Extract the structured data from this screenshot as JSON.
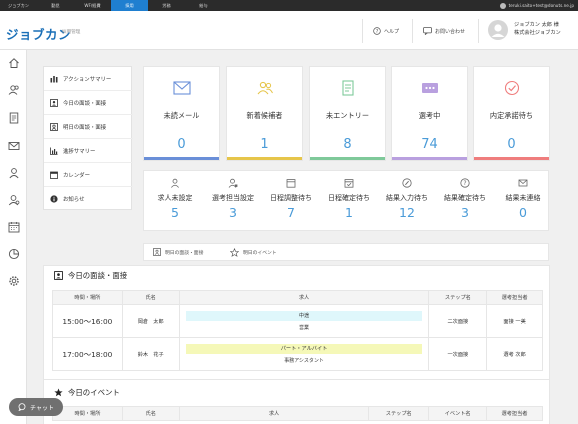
{
  "topbar": {
    "tabs": [
      "ジョブカン",
      "勤怠",
      "WF/経費",
      "採用",
      "労務",
      "給与"
    ],
    "active_index": 3,
    "user_email": "teruki.saito+test@donuts.ne.jp"
  },
  "header": {
    "logo": "ジョブカン",
    "logo_sub": "採用管理",
    "help": "ヘルプ",
    "contact": "お問い合わせ",
    "user_name": "ジョブカン 太郎 様",
    "company": "株式会社ジョブカン"
  },
  "menu": [
    {
      "label": "アクションサマリー",
      "icon": "bar-chart-icon"
    },
    {
      "label": "今日の面談・面接",
      "icon": "person-card-icon"
    },
    {
      "label": "明日の面談・面接",
      "icon": "person-card-icon"
    },
    {
      "label": "進捗サマリー",
      "icon": "progress-chart-icon"
    },
    {
      "label": "カレンダー",
      "icon": "calendar-icon"
    },
    {
      "label": "お知らせ",
      "icon": "info-icon"
    }
  ],
  "cards": [
    {
      "label": "未読メール",
      "value": "0",
      "color": "#6a8fd8",
      "icon": "mail-icon"
    },
    {
      "label": "新着候補者",
      "value": "1",
      "color": "#e6c54a",
      "icon": "people-icon"
    },
    {
      "label": "未エントリー",
      "value": "8",
      "color": "#7fc99a",
      "icon": "document-icon"
    },
    {
      "label": "選考中",
      "value": "74",
      "color": "#b9a0df",
      "icon": "message-icon"
    },
    {
      "label": "内定承諾待ち",
      "value": "0",
      "color": "#ef7d7d",
      "icon": "check-circle-icon"
    }
  ],
  "stats": [
    {
      "label": "求人未設定",
      "value": "5",
      "icon": "user-icon"
    },
    {
      "label": "選考担当設定",
      "value": "3",
      "icon": "user-lock-icon"
    },
    {
      "label": "日程調整待ち",
      "value": "7",
      "icon": "calendar-icon"
    },
    {
      "label": "日程確定待ち",
      "value": "1",
      "icon": "calendar-check-icon"
    },
    {
      "label": "結果入力待ち",
      "value": "12",
      "icon": "pen-icon"
    },
    {
      "label": "結果確定待ち",
      "value": "3",
      "icon": "question-icon"
    },
    {
      "label": "結果未連絡",
      "value": "0",
      "icon": "mail-check-icon"
    }
  ],
  "page_tabs": [
    "明日の面談・面接",
    "明日のイベント"
  ],
  "today_interviews": {
    "title": "今日の面談・面接",
    "headers": [
      "時間・場所",
      "氏名",
      "求人",
      "ステップ名",
      "選考担当者"
    ],
    "rows": [
      {
        "time": "15:00〜16:00",
        "name": "岡倉　太郎",
        "job": "中途",
        "job_color": "#dff7fb",
        "sub": "営業",
        "step": "二次面接",
        "owner": "面接 一美"
      },
      {
        "time": "17:00〜18:00",
        "name": "鈴木　花子",
        "job": "パート・アルバイト",
        "job_color": "#f5f8b8",
        "sub": "事務アシスタント",
        "step": "一次面接",
        "owner": "選考 次郎"
      }
    ]
  },
  "today_events": {
    "title": "今日のイベント",
    "headers": [
      "時間・場所",
      "氏名",
      "求人",
      "ステップ名",
      "イベント名",
      "選考担当者"
    ]
  },
  "chat": {
    "label": "チャット"
  }
}
